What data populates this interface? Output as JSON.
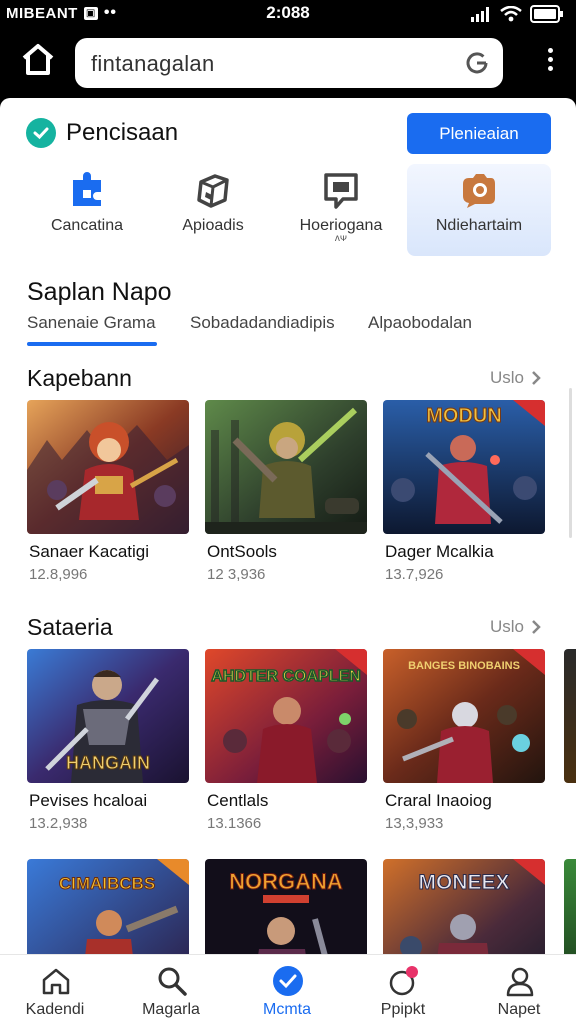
{
  "status_bar": {
    "carrier": "MIBEANT",
    "time": "2:088"
  },
  "top_bar": {
    "url_text": "fintanagalan"
  },
  "header": {
    "brand_title": "Pencisaan",
    "primary_button_label": "Plenieaian"
  },
  "quick_actions": [
    {
      "label": "Cancatina",
      "icon": "puzzle-icon"
    },
    {
      "label": "Apioadis",
      "icon": "cube-icon"
    },
    {
      "label": "Hoeriogana",
      "label_sub": "ᴧᴪ",
      "icon": "chat-icon"
    },
    {
      "label": "Ndiehartaim",
      "icon": "camera-icon"
    }
  ],
  "section": {
    "title": "Saplan Napo",
    "tabs": [
      {
        "label": "Sanenaie Grama"
      },
      {
        "label": "Sobadadandiadipis"
      },
      {
        "label": "Alpaobodalan"
      }
    ]
  },
  "rows": [
    {
      "title": "Kapebann",
      "see_all": "Uslo",
      "items": [
        {
          "title": "Sanaer Kacatigi",
          "meta": "12.8,996",
          "art": "dwarf-warrior"
        },
        {
          "title": "OntSools",
          "meta": "12 3,936",
          "art": "goblin-rogue"
        },
        {
          "title": "Dager Mcalkia",
          "meta": "13.7,926",
          "art": "blue-knight",
          "banner": "MODUN"
        }
      ]
    },
    {
      "title": "Sataeria",
      "see_all": "Uslo",
      "items": [
        {
          "title": "Pevises hcaloai",
          "meta": "13.2,938",
          "art": "dark-hero",
          "banner": "HANGAIN"
        },
        {
          "title": "Centlals",
          "meta": "13.1366",
          "art": "crimson-duel",
          "banner": "AHDTER COAPLEN"
        },
        {
          "title": "Craral Inaoiog",
          "meta": "13,3,933",
          "art": "battle-squad",
          "banner": "BANGES BINOBAINS"
        }
      ]
    },
    {
      "title": "",
      "items": [
        {
          "art": "gunner",
          "banner": "CIMAIBCBS"
        },
        {
          "art": "witch",
          "banner": "NORGANA"
        },
        {
          "art": "armored",
          "banner": "MONEEX"
        }
      ]
    }
  ],
  "bottom_nav": [
    {
      "label": "Kadendi",
      "icon": "home-icon"
    },
    {
      "label": "Magarla",
      "icon": "search-icon"
    },
    {
      "label": "Mcmta",
      "icon": "check-circle-icon"
    },
    {
      "label": "Ppipkt",
      "icon": "notification-icon"
    },
    {
      "label": "Napet",
      "icon": "profile-icon"
    }
  ],
  "colors": {
    "accent": "#1a6cf0",
    "brand_check": "#15b3a0",
    "quick_icon_blue": "#1a6cf0",
    "quick_icon_dark": "#444444",
    "quick_icon_orange": "#c8783e"
  }
}
